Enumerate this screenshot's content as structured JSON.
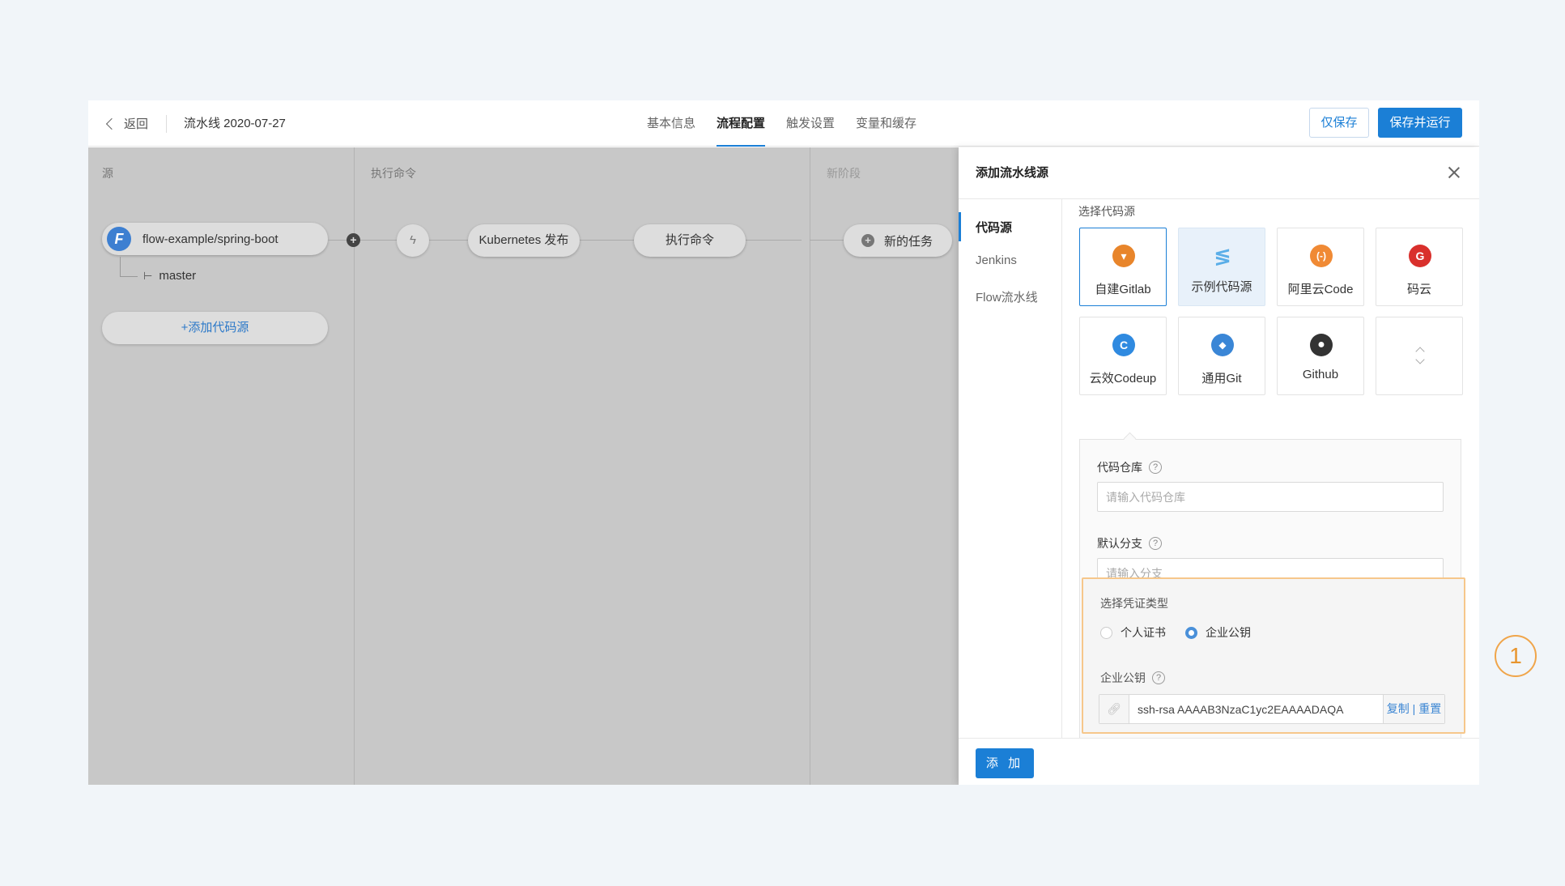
{
  "header": {
    "back_label": "返回",
    "pipeline_title": "流水线 2020-07-27",
    "tabs": [
      {
        "label": "基本信息",
        "active": false
      },
      {
        "label": "流程配置",
        "active": true
      },
      {
        "label": "触发设置",
        "active": false
      },
      {
        "label": "变量和缓存",
        "active": false
      }
    ],
    "save_only_label": "仅保存",
    "save_run_label": "保存并运行"
  },
  "canvas": {
    "stages": [
      {
        "title": "源"
      },
      {
        "title": "执行命令"
      },
      {
        "title": "新阶段"
      }
    ],
    "source": {
      "repo": "flow-example/spring-boot",
      "logo_letter": "F",
      "branch": "master",
      "branch_icon": "branch-icon",
      "add_source_label": "+添加代码源"
    },
    "tasks": [
      "Kubernetes 发布",
      "执行命令"
    ],
    "new_task_label": "新的任务"
  },
  "drawer": {
    "title": "添加流水线源",
    "nav": [
      {
        "label": "代码源",
        "active": true
      },
      {
        "label": "Jenkins",
        "active": false
      },
      {
        "label": "Flow流水线",
        "active": false
      }
    ],
    "select_source_label": "选择代码源",
    "sources": [
      {
        "label": "自建Gitlab",
        "icon": "gitlab-icon",
        "color": "#e8852b",
        "selected": true
      },
      {
        "label": "示例代码源",
        "icon": "sample-source-icon",
        "color": "#5aaee8",
        "highlight": true
      },
      {
        "label": "阿里云Code",
        "icon": "aliyun-code-icon",
        "color": "#f08a35"
      },
      {
        "label": "码云",
        "icon": "gitee-icon",
        "color": "#d9302c",
        "glyph": "G"
      },
      {
        "label": "云效Codeup",
        "icon": "codeup-icon",
        "color": "#2f8ae0",
        "glyph": "C"
      },
      {
        "label": "通用Git",
        "icon": "git-icon",
        "color": "#3a86d6",
        "glyph": "◆"
      },
      {
        "label": "Github",
        "icon": "github-icon",
        "color": "#333333",
        "glyph": "●"
      }
    ],
    "form": {
      "repo_label": "代码仓库",
      "repo_placeholder": "请输入代码仓库",
      "branch_label": "默认分支",
      "branch_placeholder": "请输入分支",
      "cred_type_label": "选择凭证类型",
      "cred_options": [
        {
          "label": "个人证书",
          "checked": false
        },
        {
          "label": "企业公钥",
          "checked": true
        }
      ],
      "key_label": "企业公钥",
      "key_value": "ssh-rsa AAAAB3NzaC1yc2EAAAADAQA",
      "copy_label": "复制",
      "reset_label": "重置"
    },
    "add_label": "添 加"
  },
  "annotation": {
    "marker": "1",
    "color": "#f0a54a"
  },
  "colors": {
    "primary": "#1b7fd6",
    "canvas_bg": "#c8c8c8",
    "page_bg": "#f1f5f9"
  }
}
